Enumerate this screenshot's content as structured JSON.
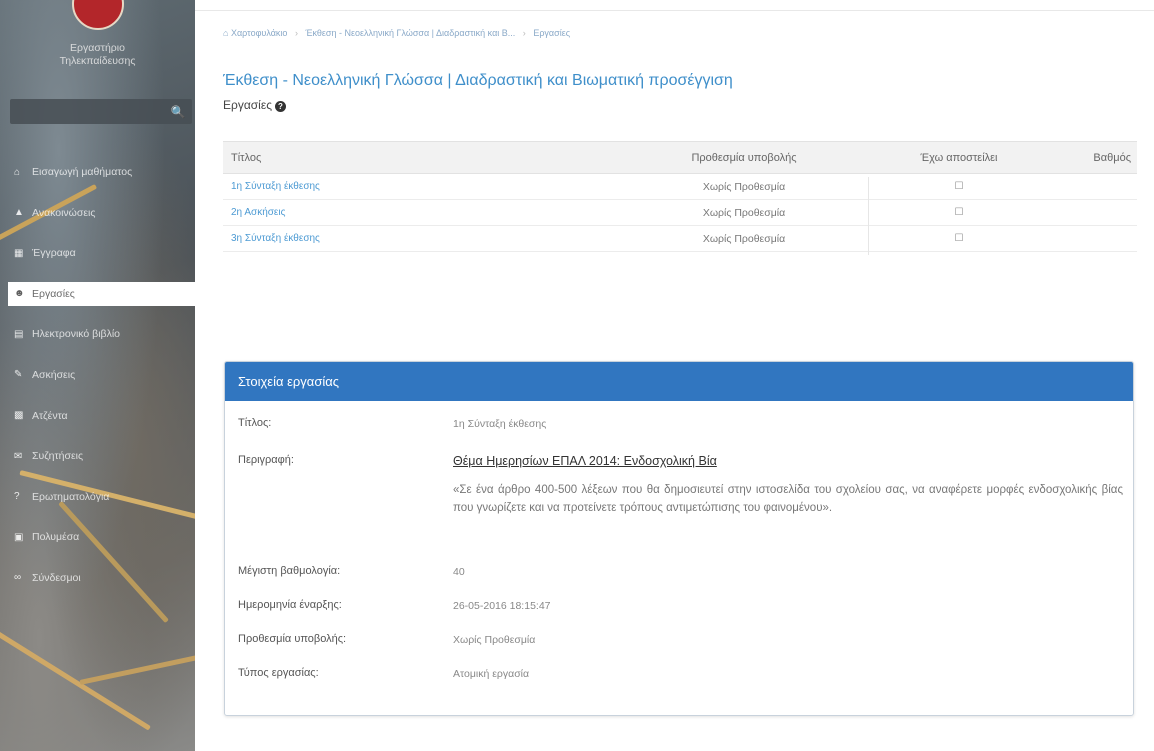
{
  "sidebar": {
    "logo_text_line1": "Εργαστήριο",
    "logo_text_line2": "Τηλεκπαίδευσης",
    "search": {
      "placeholder": ""
    },
    "items": [
      {
        "label": "Εισαγωγή μαθήματος",
        "icon": "home-icon"
      },
      {
        "label": "Ανακοινώσεις",
        "icon": "bullhorn-icon"
      },
      {
        "label": "Έγγραφα",
        "icon": "folder-icon"
      },
      {
        "label": "Εργασίες",
        "icon": "user-icon",
        "active": true
      },
      {
        "label": "Ηλεκτρονικό βιβλίο",
        "icon": "book-icon"
      },
      {
        "label": "Ασκήσεις",
        "icon": "pencil-icon"
      },
      {
        "label": "Ατζέντα",
        "icon": "calendar-icon"
      },
      {
        "label": "Συζητήσεις",
        "icon": "comments-icon"
      },
      {
        "label": "Ερωτηματολόγια",
        "icon": "question-icon"
      },
      {
        "label": "Πολυμέσα",
        "icon": "film-icon"
      },
      {
        "label": "Σύνδεσμοι",
        "icon": "link-icon"
      }
    ]
  },
  "breadcrumb": {
    "home": "Χαρτοφυλάκιο",
    "course": "Έκθεση - Νεοελληνική Γλώσσα | Διαδραστική και Β...",
    "current": "Εργασίες"
  },
  "course_title": "Έκθεση - Νεοελληνική Γλώσσα | Διαδραστική και Βιωματική προσέγγιση",
  "page_title": "Εργασίες",
  "table": {
    "headers": [
      "Τίτλος",
      "Προθεσμία υποβολής",
      "Έχω αποστείλει",
      "Βαθμός"
    ],
    "rows": [
      {
        "title": "1η Σύνταξη έκθεσης",
        "deadline": "Χωρίς Προθεσμία",
        "sent": "☐",
        "grade": ""
      },
      {
        "title": "2η Ασκήσεις",
        "deadline": "Χωρίς Προθεσμία",
        "sent": "☐",
        "grade": ""
      },
      {
        "title": "3η Σύνταξη έκθεσης",
        "deadline": "Χωρίς Προθεσμία",
        "sent": "☐",
        "grade": ""
      }
    ]
  },
  "panel": {
    "heading": "Στοιχεία εργασίας",
    "title_label": "Τίτλος:",
    "title_value": "1η Σύνταξη έκθεσης",
    "description_label": "Περιγραφή:",
    "description_title": "Θέμα Ημερησίων ΕΠΑΛ 2014: Ενδοσχολική Βία",
    "description_text": "«Σε ένα άρθρο 400-500 λέξεων που θα δημοσιευτεί στην ιστοσελίδα του σχολείου σας, να αναφέρετε μορφές ενδοσχολικής βίας που γνωρίζετε και να προτείνετε τρόπους αντιμετώπισης του φαινομένου».",
    "max_grade_label": "Μέγιστη βαθμολογία:",
    "max_grade_value": "40",
    "start_date_label": "Ημερομηνία έναρξης:",
    "start_date_value": "26-05-2016 18:15:47",
    "deadline_label": "Προθεσμία υποβολής:",
    "deadline_value": "Χωρίς Προθεσμία",
    "type_label": "Τύπος εργασίας:",
    "type_value": "Ατομική εργασία"
  },
  "colors": {
    "accent": "#3176c0",
    "link": "#4c9ad3",
    "title": "#3f8fca"
  }
}
